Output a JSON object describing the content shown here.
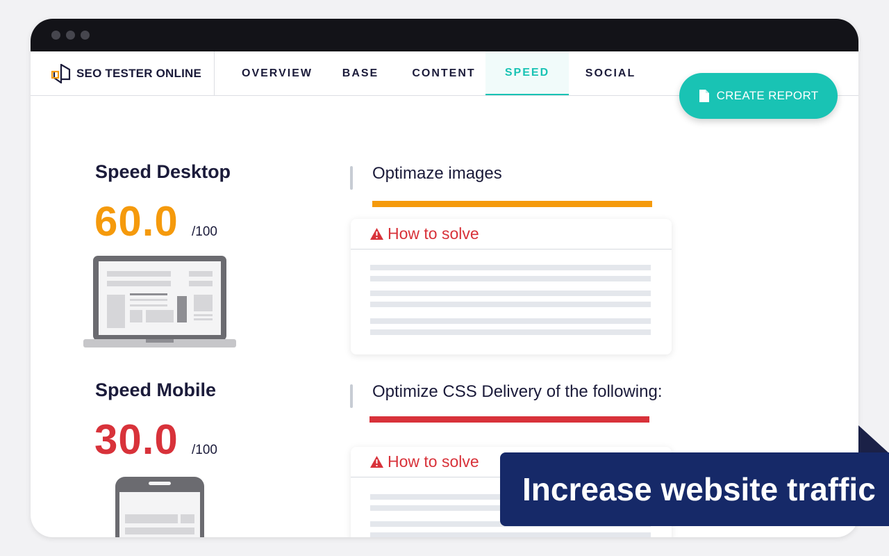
{
  "brand": {
    "name": "SEO TESTER ONLINE"
  },
  "nav": {
    "tabs": [
      {
        "label": "OVERVIEW",
        "active": false
      },
      {
        "label": "BASE",
        "active": false
      },
      {
        "label": "CONTENT",
        "active": false
      },
      {
        "label": "SPEED",
        "active": true
      },
      {
        "label": "SOCIAL",
        "active": false
      }
    ]
  },
  "actions": {
    "create_report": "CREATE REPORT"
  },
  "metrics": {
    "desktop": {
      "title": "Speed Desktop",
      "score": "60.0",
      "max": "/100",
      "color": "#f59a0c"
    },
    "mobile": {
      "title": "Speed Mobile",
      "score": "30.0",
      "max": "/100",
      "color": "#d8323a"
    }
  },
  "issues": [
    {
      "title": "Optimaze images",
      "accent": "#f59a0c",
      "solve_label": "How to solve"
    },
    {
      "title": "Optimize CSS Delivery of the following:",
      "accent": "#d8323a",
      "solve_label": "How to solve"
    }
  ],
  "banner": {
    "text": "Increase website traffic"
  },
  "colors": {
    "accent": "#19c3b4",
    "navy": "#162968",
    "text": "#1b1b3a"
  },
  "icons": {
    "logo": "logo-icon",
    "report": "document-icon",
    "warning": "warning-icon",
    "desktop": "laptop-icon",
    "mobile": "phone-icon"
  }
}
